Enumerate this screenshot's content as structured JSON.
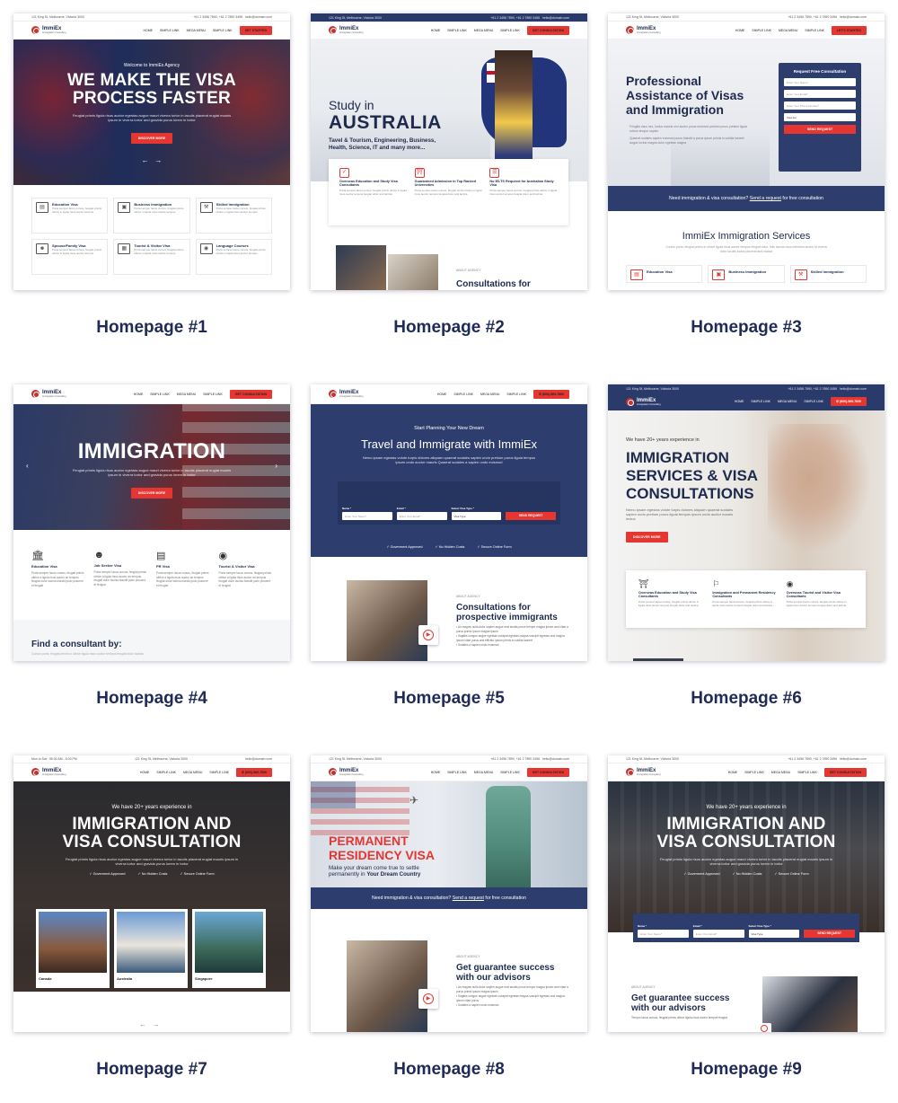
{
  "common": {
    "logo": "ImmiEx",
    "logo_sub": "Immigration Consulting",
    "address": "121 King St, Melbourne, Victoria 3000",
    "phones": "+61 2 3456 7890, +61 2 7890 3456",
    "email": "hello@domain.com",
    "hours": "Mon to Sat : 08.00 AM - 5.00 PM",
    "menu": [
      "HOME",
      "SIMPLE LINK",
      "MEGA MENU",
      "SIMPLE LINK"
    ],
    "cta_started": "GET STARTED",
    "cta_consult": "GET CONSULTATION",
    "cta_consult_caps": "LET'S STARTED",
    "phone_cta": "(800)-569-7890",
    "lorem": "Feugiat primis ligula risus auctor egestas augue mauri viverra tortor in iaculis placerat eugiat mauris ipsum in viverra tortor and gravida purus lorem in tortor",
    "discover": "DISCOVER MORE"
  },
  "cards": [
    {
      "caption": "Homepage #1",
      "welcome": "Welcome to ImmiEx Agency",
      "title_line1": "WE MAKE THE VISA",
      "title_line2": "PROCESS FASTER",
      "services": [
        {
          "icon": "passport-icon",
          "title": "Education Visa",
          "desc": "Porta semper lacus cursus, feugiat primis ultrice in ligula risus auctor tempus"
        },
        {
          "icon": "briefcase-icon",
          "title": "Business Immigration",
          "desc": "Porta semper lacus cursus, feugiat primis ultrice in ligula risus auctor tempus"
        },
        {
          "icon": "wrench-icon",
          "title": "Skilled Immigration",
          "desc": "Porta semper lacus cursus, feugiat primis ultrice in ligula risus auctor tempus"
        },
        {
          "icon": "people-icon",
          "title": "Spouse/Family Visa",
          "desc": "Porta semper lacus cursus, feugiat primis ultrice in ligula risus auctor tempus"
        },
        {
          "icon": "suitcase-icon",
          "title": "Tourist & Visitor Visa",
          "desc": "Porta semper lacus cursus, feugiat primis ultrice in ligula risus auctor tempus"
        },
        {
          "icon": "globe-icon",
          "title": "Language Courses",
          "desc": "Porta semper lacus cursus, feugiat primis ultrice in ligula risus auctor tempus"
        }
      ]
    },
    {
      "caption": "Homepage #2",
      "title_small": "Study in",
      "title_big": "AUSTRALIA",
      "subtitle": "Tavel & Tourism, Engineering, Business, Health, Science, IT and many more...",
      "features": [
        {
          "title": "Overseas Education and Study Visa Consultants",
          "desc": "Porta semper lacus cursus, feugiat primis ultrice in ligula risus auctor tempus feugiat dolor and lacinia"
        },
        {
          "title": "Guaranteed Admission in Top Ranked Universities",
          "desc": "Porta semper lacus cursus, feugiat primis ultrice in ligula risus auctor tempus feugiat dolor and lacinia"
        },
        {
          "title": "No IELTS Required for Australian Study Visa",
          "desc": "Porta semper lacus cursus, feugiat primis ultrice in ligula risus auctor tempus feugiat dolor and lacinia"
        }
      ],
      "about_label": "ABOUT AGENCY",
      "about_title": "Consultations for"
    },
    {
      "caption": "Homepage #3",
      "title": "Professional Assistance of Visas and Immigration",
      "bullets": [
        "Fringilla risus nec, luctus mauris orci auctor purus euismod pretium purus pretium ligula rutrum tempor sapien",
        "Quaerat sodales sapien euismod purus blandit a purus ipsum primis in cubilia laoreet augue luctus magna dolor egestas magna"
      ],
      "form_title": "Request Free Consultation",
      "form_fields": [
        "Enter Your Name*",
        "Enter Your Email*",
        "Enter Your Phone Number*",
        "Visa For"
      ],
      "form_btn": "SEND REQUEST",
      "banner": "Need immigration & visa consultation?",
      "banner_link": "Send a request",
      "banner_tail": "for free consultation",
      "section_title": "ImmiEx Immigration Services",
      "section_desc": "Cursus porta, feugiat primis in ultrice ligula risus auctor tempus feugiat dolor, felis lacinia risus interdum auctor id viverra dolor iaculis luctus placerat and massa",
      "services": [
        "Education Visa",
        "Business Immigration",
        "Skilled Immigration"
      ]
    },
    {
      "caption": "Homepage #4",
      "title": "IMMIGRATION",
      "services": [
        {
          "title": "Education Visa",
          "desc": "Porta semper lacus cursus, feugiat primis ultrice a ligula risus auctor an tempus feugiat dolor lacinia blandit justo posuere et feugiat"
        },
        {
          "title": "Job Seeker Visa",
          "desc": "Porta semper lacus cursus, feugiat primis ultrice a ligula risus auctor an tempus feugiat dolor lacinia blandit justo posuere et feugiat"
        },
        {
          "title": "PR Visa",
          "desc": "Porta semper lacus cursus, feugiat primis ultrice a ligula risus auctor an tempus feugiat dolor lacinia blandit justo posuere et feugiat"
        },
        {
          "title": "Tourist & Visitor Visa",
          "desc": "Porta semper lacus cursus, feugiat primis ultrice a ligula risus auctor an tempus feugiat dolor lacinia blandit justo posuere et feugiat"
        }
      ],
      "find_title": "Find a consultant by:",
      "find_desc": "Cursus porta, feugiat primis in ultrice ligula risus auctor tempus feugiat dolor lacinia"
    },
    {
      "caption": "Homepage #5",
      "eyebrow": "Start Planning Your New Dream",
      "title": "Travel and Immigrate with ImmiEx",
      "desc": "Nemo ipsam egestas volute turpis dolores aliquam quaerat sodales sapien undo pretium purus ligula tempus ipsum undo auctor mauris Quaerat sodales a sapien undo euismod",
      "labels": [
        "Name *",
        "Email *",
        "Select Visa Type *"
      ],
      "placeholders": [
        "Enter Your Name*",
        "Enter Your Email*",
        "Visa Type"
      ],
      "btn": "SEND REQUEST",
      "badges": [
        "Goverment Approved",
        "No Hidden Costs",
        "Secure Online Form"
      ],
      "about_label": "ABOUT AGENCY",
      "about_title": "Consultations for prospective immigrants",
      "bullets": [
        "An magnis nulla dolor sapien augue erat iaculis purus tempor magna ipsum and vitae a purus primis ipsum magna ipsum",
        "Sagittis congue augue egestas volutpat egestas magna suscipit egestas and magna ipsum vitae purus and efficitur ipsum primis in cubilia laoreet",
        "Sodales a sapien undo euismod"
      ]
    },
    {
      "caption": "Homepage #6",
      "eyebrow": "We have 20+ years experience in",
      "title_line1": "IMMIGRATION",
      "title_line2": "SERVICES & VISA",
      "title_line3": "CONSULTATIONS",
      "desc": "Nemo ipsam egestas volute turpis dolores aliquam quaerat sodales sapien undo pretium purus ligula tempus ipsum undo auctor mauris lectus",
      "features": [
        {
          "title": "Overseas Education and Study Visa Consultants",
          "desc": "Porta semper lacus cursus, feugiat primis ultrice in ligula risus auctor tempus feugiat dolor and lacinia"
        },
        {
          "title": "Immigration and Permanent Residency Consultants",
          "desc": "Porta semper lacus cursus, feugiat primis ultrice in ligula risus auctor tempus feugiat dolor and lacinia"
        },
        {
          "title": "Overseas Tourist and Visitor Visa Consultants",
          "desc": "Porta semper lacus cursus, feugiat primis ultrice in ligula risus auctor tempus feugiat dolor and lacinia"
        }
      ]
    },
    {
      "caption": "Homepage #7",
      "eyebrow": "We have 20+ years experience in",
      "title_line1": "IMMIGRATION AND",
      "title_line2": "VISA CONSULTATION",
      "badges": [
        "Goverment Approved",
        "No Hidden Costs",
        "Secure Online Form"
      ],
      "cities": [
        "Canada",
        "Australia",
        "Singapore"
      ]
    },
    {
      "caption": "Homepage #8",
      "title_line1": "PERMANENT",
      "title_line2": "RESIDENCY VISA",
      "sub_line1": "Make your dream come true to settle",
      "sub_line2_a": "permanently in",
      "sub_line2_b": "Your Dream Country",
      "banner": "Need immigration & visa consultation?",
      "banner_link": "Send a request",
      "banner_tail": "for free consultation",
      "about_label": "ABOUT AGENCY",
      "about_title": "Get guarantee success with our advisors",
      "bullets": [
        "An magnis nulla dolor sapien augue erat iaculis purus tempor magna ipsum and vitae a purus primis ipsum magna ipsum",
        "Sagittis congue augue egestas volutpat egestas magna suscipit egestas and magna ipsum vitae purus",
        "Sodales a sapien undo euismod"
      ]
    },
    {
      "caption": "Homepage #9",
      "eyebrow": "We have 20+ years experience in",
      "title_line1": "IMMIGRATION AND",
      "title_line2": "VISA CONSULTATION",
      "badges": [
        "Goverment Approved",
        "No Hidden Costs",
        "Secure Online Form"
      ],
      "labels": [
        "Name *",
        "Email *",
        "Select Visa Type *"
      ],
      "placeholders": [
        "Enter Your Name*",
        "Enter Your Email*",
        "Visa Type"
      ],
      "btn": "SEND REQUEST",
      "about_label": "ABOUT AGENCY",
      "about_title": "Get guarantee success with our advisors",
      "about_desc": "Tempor lacus cursus, feugiat primis ultrice ligula risus auctor tempus feugiat"
    }
  ],
  "colors": {
    "navy": "#1d2a4d",
    "red": "#e63631",
    "banner_blue": "#2d3e6e"
  }
}
